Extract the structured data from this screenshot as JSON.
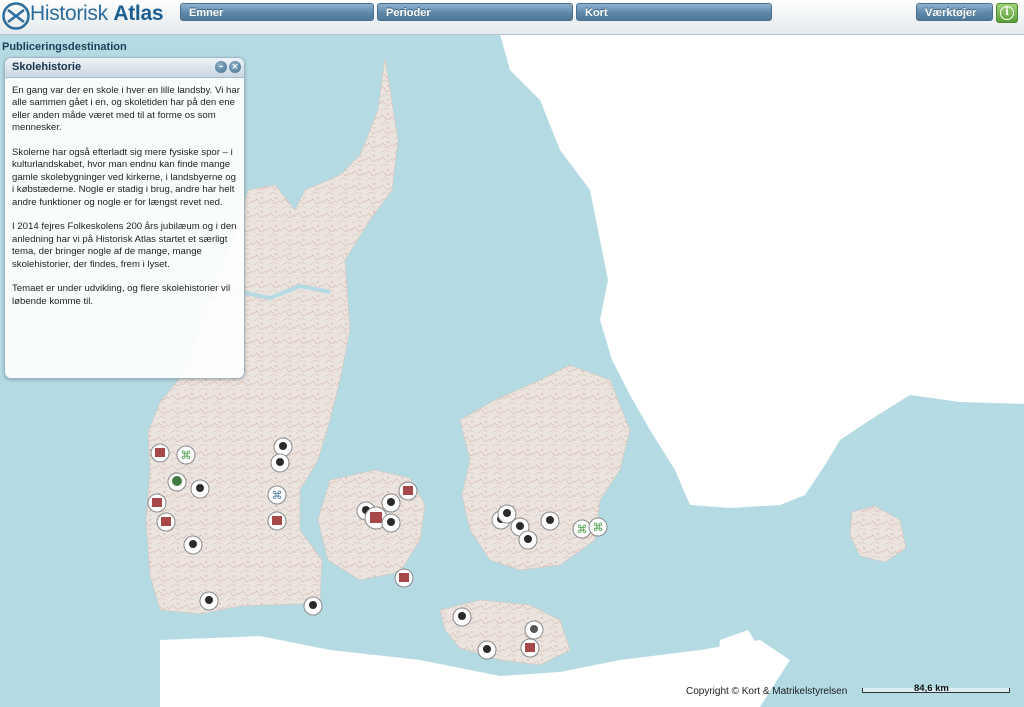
{
  "app": {
    "title_light": "Historisk",
    "title_bold": "Atlas"
  },
  "menu": {
    "emner": "Emner",
    "perioder": "Perioder",
    "kort": "Kort",
    "tools": "Værktøjer",
    "info_glyph": "i"
  },
  "publication_label": "Publiceringsdestination",
  "panel": {
    "title": "Skolehistorie",
    "paragraphs": [
      "En gang var der en skole i hver en lille landsby. Vi har alle sammen gået i en, og skoletiden har på den ene eller anden måde været med til at forme os som mennesker.",
      "Skolerne har også efterladt sig mere fysiske spor – i kulturlandskabet, hvor man endnu kan finde mange gamle skolebygninger ved kirkerne, i landsbyerne og i købstæderne. Nogle er stadig i brug, andre har helt andre funktioner og nogle er for længst revet ned.",
      "I 2014 fejres Folkeskolens 200 års jubilæum og i den anledning har vi på Historisk Atlas startet et særligt tema, der bringer nogle af de mange, mange skolehistorier, der findes, frem i lyset.",
      "Temaet er under udvikling, og flere skolehistorier vil løbende komme til."
    ]
  },
  "footer": {
    "copyright": "Copyright © Kort & Matrikelstyrelsen",
    "scale": "84,6 km"
  },
  "colors": {
    "sea": "#b4dbe3",
    "land": "#ebe4de",
    "sweden": "#ffffff",
    "menu_blue": "#5f88a8",
    "info_green": "#5a9e37"
  },
  "markers": {
    "icon_types": [
      "school-building-icon",
      "teacher-icon",
      "pupils-group-icon",
      "cross-symbol-icon",
      "tree-icon"
    ],
    "count": 34
  }
}
